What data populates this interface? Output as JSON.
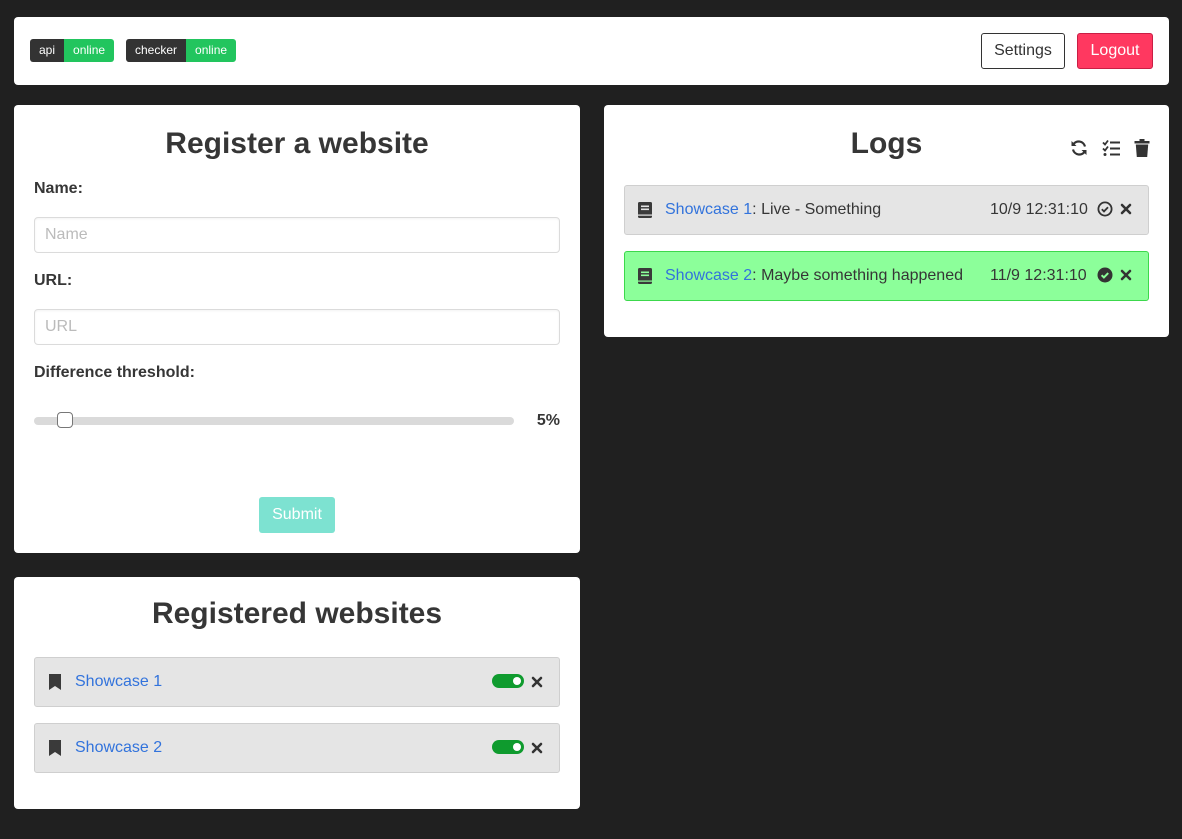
{
  "topbar": {
    "badges": [
      {
        "label": "api",
        "status": "online"
      },
      {
        "label": "checker",
        "status": "online"
      }
    ],
    "settings_label": "Settings",
    "logout_label": "Logout"
  },
  "register": {
    "title": "Register a website",
    "name_label": "Name:",
    "name_placeholder": "Name",
    "name_value": "",
    "url_label": "URL:",
    "url_placeholder": "URL",
    "url_value": "",
    "threshold_label": "Difference threshold:",
    "threshold_value": 5,
    "threshold_display": "5%",
    "submit_label": "Submit"
  },
  "registered": {
    "title": "Registered websites",
    "sites": [
      {
        "name": "Showcase 1",
        "enabled": true
      },
      {
        "name": "Showcase 2",
        "enabled": true
      }
    ]
  },
  "logs": {
    "title": "Logs",
    "entries": [
      {
        "site": "Showcase 1",
        "message": ": Live - Something",
        "time": "10/9 12:31:10",
        "read": false,
        "highlighted": false
      },
      {
        "site": "Showcase 2",
        "message": ": Maybe something happened",
        "time": "11/9 12:31:10",
        "read": true,
        "highlighted": true
      }
    ]
  },
  "colors": {
    "background": "#202020",
    "online": "#22c55e",
    "logout": "#ff3860",
    "submit": "#7de2d1",
    "link": "#3273dc",
    "toggle_on": "#0f9b2e",
    "log_highlight": "#8cff9a"
  },
  "icons": {
    "refresh": "refresh-icon",
    "mark_all_read": "checklist-icon",
    "clear": "trash-icon",
    "log_entry": "book-icon",
    "site_entry": "bookmark-icon",
    "remove": "close-icon",
    "read_state": "check-circle-icon"
  }
}
